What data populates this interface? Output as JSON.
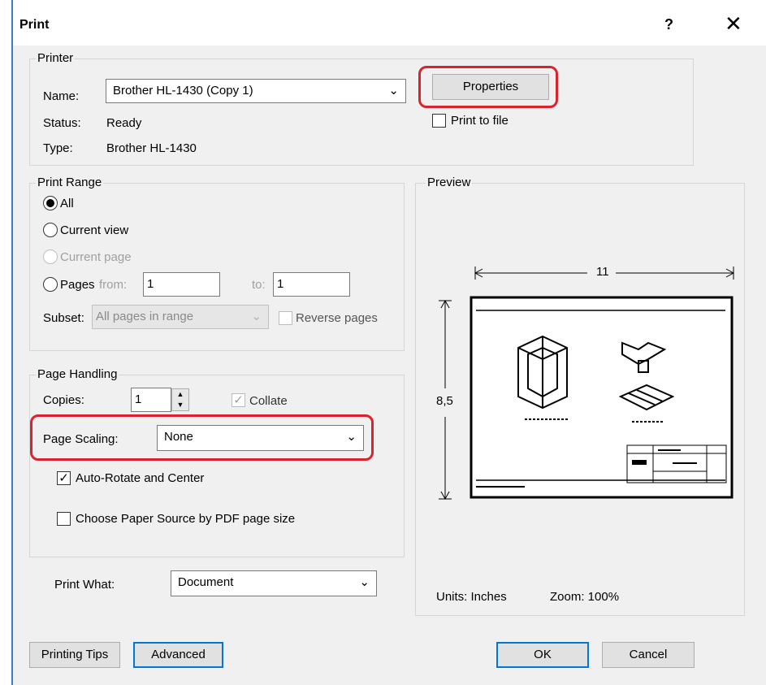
{
  "window": {
    "title": "Print",
    "help": "?",
    "close": "✕"
  },
  "printer": {
    "group_label": "Printer",
    "name_label": "Name:",
    "name_value": "Brother HL-1430 (Copy 1)",
    "status_label": "Status:",
    "status_value": "Ready",
    "type_label": "Type:",
    "type_value": "Brother HL-1430",
    "properties_button": "Properties",
    "print_to_file_label": "Print to file",
    "print_to_file_checked": false
  },
  "print_range": {
    "group_label": "Print Range",
    "options": [
      "All",
      "Current view",
      "Current page",
      "Pages"
    ],
    "selected": "All",
    "from_label": "from:",
    "from_value": "1",
    "to_label": "to:",
    "to_value": "1",
    "subset_label": "Subset:",
    "subset_value": "All pages in range",
    "reverse_pages_label": "Reverse pages"
  },
  "page_handling": {
    "group_label": "Page Handling",
    "copies_label": "Copies:",
    "copies_value": "1",
    "collate_label": "Collate",
    "page_scaling_label": "Page Scaling:",
    "page_scaling_value": "None",
    "auto_rotate_label": "Auto-Rotate and Center",
    "auto_rotate_checked": true,
    "paper_source_label": "Choose Paper Source by PDF page size",
    "paper_source_checked": false,
    "print_what_label": "Print What:",
    "print_what_value": "Document"
  },
  "preview": {
    "group_label": "Preview",
    "width_label": "11",
    "height_label": "8,5",
    "units_label": "Units: Inches",
    "zoom_label": "Zoom: 100%"
  },
  "footer": {
    "printing_tips": "Printing Tips",
    "advanced": "Advanced",
    "ok": "OK",
    "cancel": "Cancel"
  },
  "colors": {
    "highlight": "#d9232d",
    "default_button_border": "#0078d7",
    "dialog_bg": "#f0f0f0"
  }
}
